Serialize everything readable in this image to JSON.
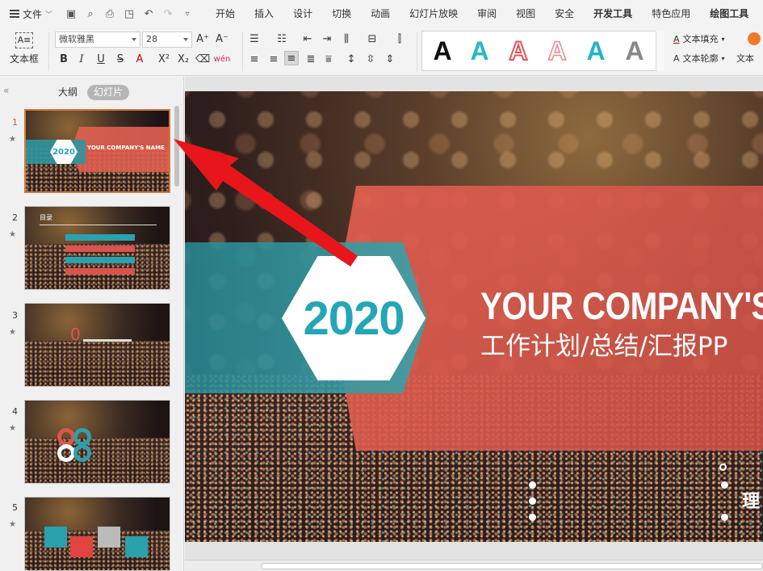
{
  "menubar": {
    "file_label": "文件",
    "tabs": [
      "开始",
      "插入",
      "设计",
      "切换",
      "动画",
      "幻灯片放映",
      "审阅",
      "视图",
      "安全",
      "开发工具",
      "特色应用",
      "绘图工具"
    ]
  },
  "ribbon": {
    "textbox_label": "文本框",
    "font_name": "微软雅黑",
    "font_size": "28",
    "text_fill_label": "文本填充",
    "text_outline_label": "文本轮廓",
    "text_effect_label": "文本",
    "wordart_letter": "A"
  },
  "left_panel": {
    "tab_outline": "大纲",
    "tab_slides": "幻灯片",
    "slides": [
      {
        "num": "1",
        "title": "YOUR COMPANY'S NAME",
        "year": "2020"
      },
      {
        "num": "2",
        "title": "目录"
      },
      {
        "num": "3",
        "title": "0"
      },
      {
        "num": "4"
      },
      {
        "num": "5"
      }
    ]
  },
  "slide": {
    "year": "2020",
    "title": "YOUR COMPANY'S",
    "subtitle": "工作计划/总结/汇报PP",
    "edge_char": "理"
  },
  "colors": {
    "accent_teal": "#23a6b6",
    "ribbon_red": "#e15f50",
    "arrow_red": "#e8151b"
  }
}
